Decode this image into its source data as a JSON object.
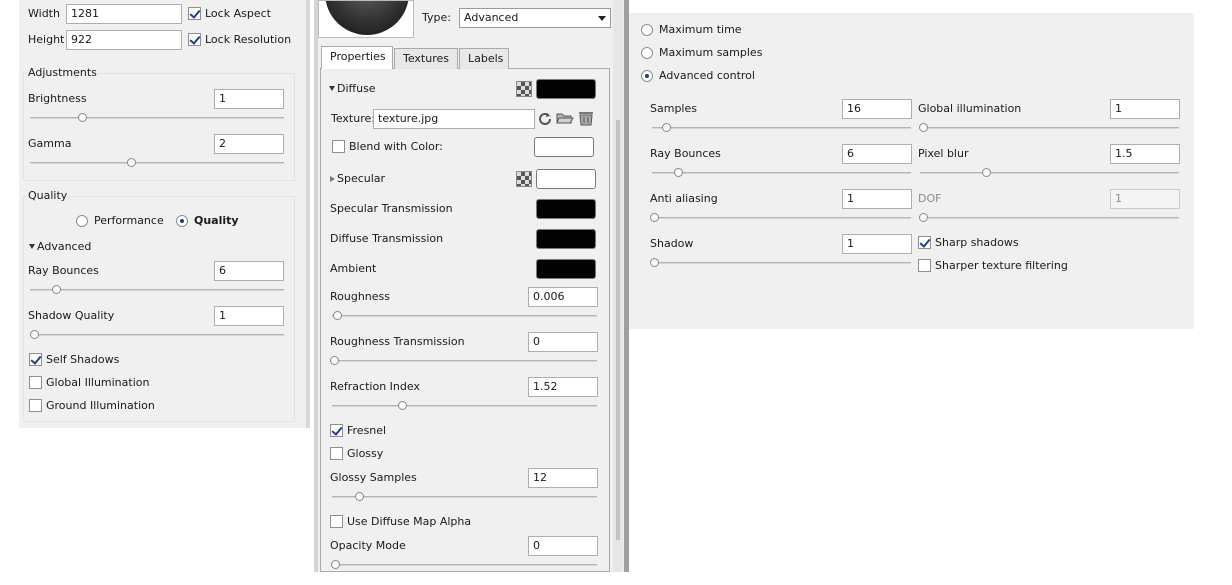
{
  "left": {
    "width_label": "Width",
    "width_value": "1281",
    "height_label": "Height",
    "height_value": "922",
    "lock_aspect_label": "Lock Aspect",
    "lock_aspect_checked": true,
    "lock_resolution_label": "Lock Resolution",
    "lock_resolution_checked": true,
    "adjustments_title": "Adjustments",
    "brightness_label": "Brightness",
    "brightness_value": "1",
    "gamma_label": "Gamma",
    "gamma_value": "2",
    "quality_title": "Quality",
    "performance_label": "Performance",
    "quality_label": "Quality",
    "advanced_label": "Advanced",
    "ray_bounces_label": "Ray Bounces",
    "ray_bounces_value": "6",
    "shadow_quality_label": "Shadow Quality",
    "shadow_quality_value": "1",
    "self_shadows_label": "Self Shadows",
    "self_shadows_checked": true,
    "global_illumination_label": "Global Illumination",
    "global_illumination_checked": false,
    "ground_illumination_label": "Ground Illumination",
    "ground_illumination_checked": false
  },
  "middle": {
    "type_label": "Type:",
    "type_value": "Advanced",
    "tabs": [
      {
        "label": "Properties",
        "active": true
      },
      {
        "label": "Textures",
        "active": false
      },
      {
        "label": "Labels",
        "active": false
      }
    ],
    "diffuse_label": "Diffuse",
    "texture_label": "Texture:",
    "texture_value": "texture.jpg",
    "blend_label": "Blend with Color:",
    "specular_label": "Specular",
    "specular_transmission_label": "Specular Transmission",
    "diffuse_transmission_label": "Diffuse Transmission",
    "ambient_label": "Ambient",
    "roughness_label": "Roughness",
    "roughness_value": "0.006",
    "roughness_transmission_label": "Roughness Transmission",
    "roughness_transmission_value": "0",
    "refraction_index_label": "Refraction Index",
    "refraction_index_value": "1.52",
    "fresnel_label": "Fresnel",
    "fresnel_checked": true,
    "glossy_label": "Glossy",
    "glossy_checked": false,
    "glossy_samples_label": "Glossy Samples",
    "glossy_samples_value": "12",
    "use_diffuse_alpha_label": "Use Diffuse Map Alpha",
    "opacity_mode_label": "Opacity Mode",
    "opacity_mode_value": "0"
  },
  "right": {
    "max_time_label": "Maximum time",
    "max_samples_label": "Maximum samples",
    "advanced_control_label": "Advanced control",
    "samples_label": "Samples",
    "samples_value": "16",
    "global_illumination_label": "Global illumination",
    "global_illumination_value": "1",
    "ray_bounces_label": "Ray Bounces",
    "ray_bounces_value": "6",
    "pixel_blur_label": "Pixel blur",
    "pixel_blur_value": "1.5",
    "anti_aliasing_label": "Anti aliasing",
    "anti_aliasing_value": "1",
    "dof_label": "DOF",
    "dof_value": "1",
    "shadow_label": "Shadow",
    "shadow_value": "1",
    "sharp_shadows_label": "Sharp shadows",
    "sharp_shadows_checked": true,
    "sharper_texture_label": "Sharper texture filtering",
    "sharper_texture_checked": false
  },
  "icons": [
    "checker-icon",
    "refresh-icon",
    "folder-open-icon",
    "trash-icon",
    "chevron-down-icon"
  ],
  "colors": {
    "panel": "#f0f0f0",
    "accent": "#1f3c88",
    "swatch_black": "#030303"
  }
}
